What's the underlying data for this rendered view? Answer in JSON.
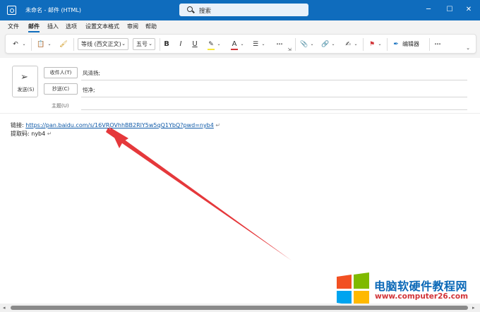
{
  "window": {
    "title": "未命名 - 邮件 (HTML)",
    "search_placeholder": "搜索",
    "minimize_glyph": "─",
    "maximize_glyph": "☐",
    "close_glyph": "✕"
  },
  "menu": {
    "items": [
      "文件",
      "邮件",
      "插入",
      "选项",
      "设置文本格式",
      "审阅",
      "帮助"
    ],
    "active": "邮件"
  },
  "ribbon": {
    "font_name": "等线 (西文正文)",
    "font_size": "五号",
    "bold": "B",
    "italic": "I",
    "underline": "U",
    "more": "···",
    "editor_label": "编辑器",
    "highlight_color": "#f7e63a",
    "font_color": "#d13438",
    "flag_color": "#d13438"
  },
  "compose": {
    "send_label": "发送(S)",
    "to_button": "收件人(T)",
    "to_value": "风清扬;",
    "cc_button": "抄送(C)",
    "cc_value": "恒净;",
    "subject_label": "主题(U)"
  },
  "body": {
    "link_label": "链接: ",
    "link_url": "https://pan.baidu.com/s/16VROVhhBB2RlY5w5qQ1YbQ?pwd=nyb4",
    "code_label": "提取码: ",
    "code_value": "nyb4",
    "para_mark": "↵"
  },
  "watermark": {
    "site_name": "电脑软硬件教程网",
    "site_url": "www.computer26.com"
  },
  "colors": {
    "title_bar": "#0f6cbd",
    "annotation_arrow": "#e5383b",
    "link": "#0f5aa8"
  }
}
